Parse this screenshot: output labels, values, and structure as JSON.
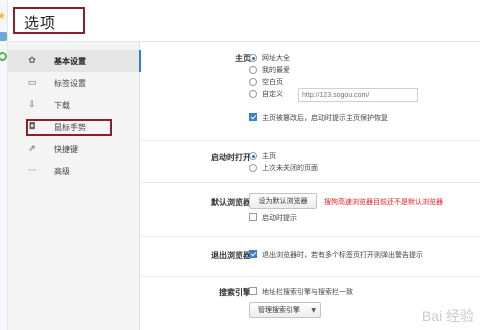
{
  "header": {
    "title": "选项"
  },
  "sidebar": {
    "items": [
      {
        "label": "基本设置",
        "icon": "gear-icon",
        "glyph": "✿"
      },
      {
        "label": "标签设置",
        "icon": "tab-icon",
        "glyph": "▭"
      },
      {
        "label": "下载",
        "icon": "download-icon",
        "glyph": "⇩"
      },
      {
        "label": "鼠标手势",
        "icon": "mouse-icon",
        "glyph": "◘"
      },
      {
        "label": "快捷键",
        "icon": "shortcut-icon",
        "glyph": "⇗"
      },
      {
        "label": "高级",
        "icon": "more-icon",
        "glyph": "···"
      }
    ],
    "active_index": 0,
    "highlighted_index": 3
  },
  "homepage": {
    "title": "主页",
    "options": [
      "网址大全",
      "我的最爱",
      "空白页",
      "自定义"
    ],
    "selected": 0,
    "custom_url_placeholder": "http://123.sogou.com/",
    "protect_label": "主页被篡改后，启动时提示主页保护恢复",
    "protect_checked": true
  },
  "startup": {
    "title": "启动时打开",
    "options": [
      "主页",
      "上次未关闭的页面"
    ],
    "selected": 0
  },
  "default_browser": {
    "title": "默认浏览器",
    "button_label": "设为默认浏览器",
    "warning": "搜狗高速浏览器目前还不是默认浏览器",
    "startup_prompt_label": "启动时提示",
    "startup_prompt_checked": false
  },
  "exit_browser": {
    "title": "退出浏览器",
    "label": "退出浏览器时，若有多个标签页打开则弹出警告提示",
    "checked": true
  },
  "search_engine": {
    "title": "搜索引擎",
    "sync_label": "地址栏搜索引擎与搜索栏一致",
    "sync_checked": false,
    "manage_label": "管理搜索引擎",
    "manage_arrow": "▼"
  },
  "watermark": "Bai 经验",
  "colors": {
    "accent": "#2f7fd0",
    "highlight_border": "#8a1e2b",
    "warning": "#e02020"
  }
}
